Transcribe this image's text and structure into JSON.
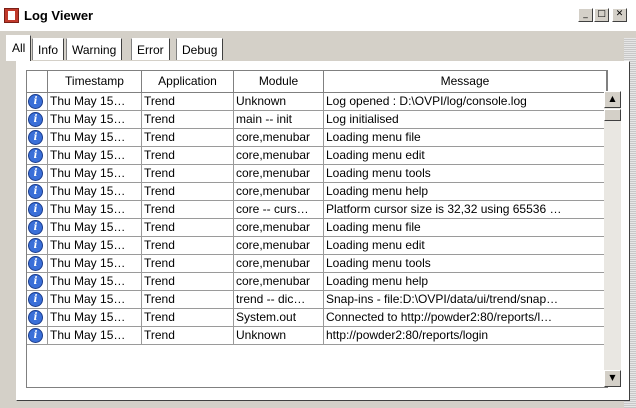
{
  "window": {
    "title": "Log Viewer",
    "min_glyph": "_",
    "max_glyph": "□",
    "close_glyph": "✕"
  },
  "tabs": [
    {
      "label": "All",
      "active": true
    },
    {
      "label": "Info",
      "active": false
    },
    {
      "label": "Warning",
      "active": false
    },
    {
      "label": "Error",
      "active": false
    },
    {
      "label": "Debug",
      "active": false
    }
  ],
  "table": {
    "columns": [
      "",
      "Timestamp",
      "Application",
      "Module",
      "Message"
    ],
    "rows": [
      {
        "icon": "info-icon",
        "timestamp": "Thu May 15…",
        "application": "Trend",
        "module": "Unknown",
        "message": "Log opened : D:\\OVPI/log/console.log"
      },
      {
        "icon": "info-icon",
        "timestamp": "Thu May 15…",
        "application": "Trend",
        "module": "main -- init",
        "message": "Log initialised"
      },
      {
        "icon": "info-icon",
        "timestamp": "Thu May 15…",
        "application": "Trend",
        "module": "core,menubar",
        "message": "Loading menu file"
      },
      {
        "icon": "info-icon",
        "timestamp": "Thu May 15…",
        "application": "Trend",
        "module": "core,menubar",
        "message": "Loading menu edit"
      },
      {
        "icon": "info-icon",
        "timestamp": "Thu May 15…",
        "application": "Trend",
        "module": "core,menubar",
        "message": "Loading menu tools"
      },
      {
        "icon": "info-icon",
        "timestamp": "Thu May 15…",
        "application": "Trend",
        "module": "core,menubar",
        "message": "Loading menu help"
      },
      {
        "icon": "info-icon",
        "timestamp": "Thu May 15…",
        "application": "Trend",
        "module": "core -- curs…",
        "message": "Platform cursor size is 32,32 using 65536 …"
      },
      {
        "icon": "info-icon",
        "timestamp": "Thu May 15…",
        "application": "Trend",
        "module": "core,menubar",
        "message": "Loading menu file"
      },
      {
        "icon": "info-icon",
        "timestamp": "Thu May 15…",
        "application": "Trend",
        "module": "core,menubar",
        "message": "Loading menu edit"
      },
      {
        "icon": "info-icon",
        "timestamp": "Thu May 15…",
        "application": "Trend",
        "module": "core,menubar",
        "message": "Loading menu tools"
      },
      {
        "icon": "info-icon",
        "timestamp": "Thu May 15…",
        "application": "Trend",
        "module": "core,menubar",
        "message": "Loading menu help"
      },
      {
        "icon": "info-icon",
        "timestamp": "Thu May 15…",
        "application": "Trend",
        "module": "trend -- dic…",
        "message": "Snap-ins - file:D:\\OVPI/data/ui/trend/snap…"
      },
      {
        "icon": "info-icon",
        "timestamp": "Thu May 15…",
        "application": "Trend",
        "module": "System.out",
        "message": "Connected to http://powder2:80/reports/l…"
      },
      {
        "icon": "info-icon",
        "timestamp": "Thu May 15…",
        "application": "Trend",
        "module": "Unknown",
        "message": "http://powder2:80/reports/login"
      }
    ]
  },
  "scrollbar": {
    "up_glyph": "▲",
    "down_glyph": "▼"
  },
  "colors": {
    "face": "#d4d0c8",
    "info_icon": "#3a6fd8"
  }
}
